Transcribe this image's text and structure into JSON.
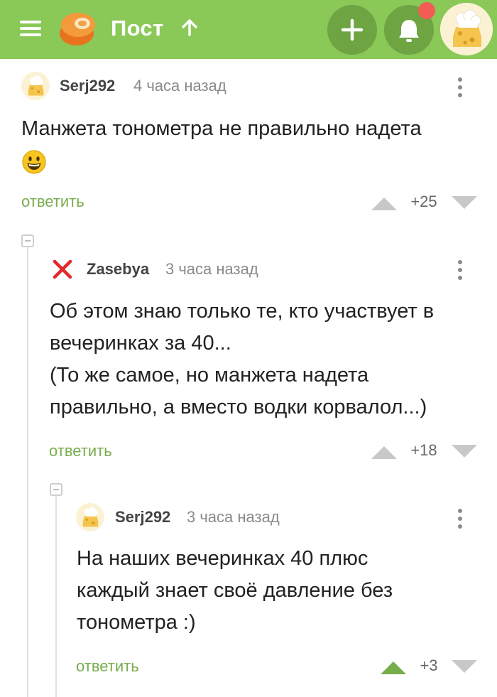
{
  "header": {
    "title": "Пост",
    "menu_icon": "hamburger-menu-icon",
    "logo_icon": "pikabu-logo-icon",
    "scroll_top_icon": "arrow-up-icon",
    "add_icon": "plus-icon",
    "notifications_icon": "bell-icon",
    "notification_badge": true,
    "avatar_icon": "chef-avatar-icon",
    "colors": {
      "bar": "#8ac858",
      "button": "#6ea442",
      "badge": "#f25c54"
    }
  },
  "comments": [
    {
      "username": "Serj292",
      "time": "4 часа назад",
      "text_lines": [
        "Манжета тонометра не правильно надета"
      ],
      "emoji": "grinning-face-emoji",
      "reply_label": "ответить",
      "score": "+25",
      "voted_up": false
    },
    {
      "username": "Zasebya",
      "time": "3 часа назад",
      "avatar_icon": "red-x-icon",
      "text_lines": [
        "Об этом знаю только те, кто участвует в",
        "вечеринках за 40...",
        "(То же самое, но манжета надета",
        "правильно, а вместо водки корвалол...)"
      ],
      "reply_label": "ответить",
      "score": "+18",
      "voted_up": false
    },
    {
      "username": "Serj292",
      "time": "3 часа назад",
      "text_lines": [
        "На наших вечеринках 40 плюс",
        "каждый знает своё давление без",
        "тонометра :)"
      ],
      "reply_label": "ответить",
      "score": "+3",
      "voted_up": true
    }
  ],
  "colors": {
    "reply": "#78ad4c",
    "vote_active": "#78ad4c",
    "vote_inactive": "#c8c8c8"
  }
}
